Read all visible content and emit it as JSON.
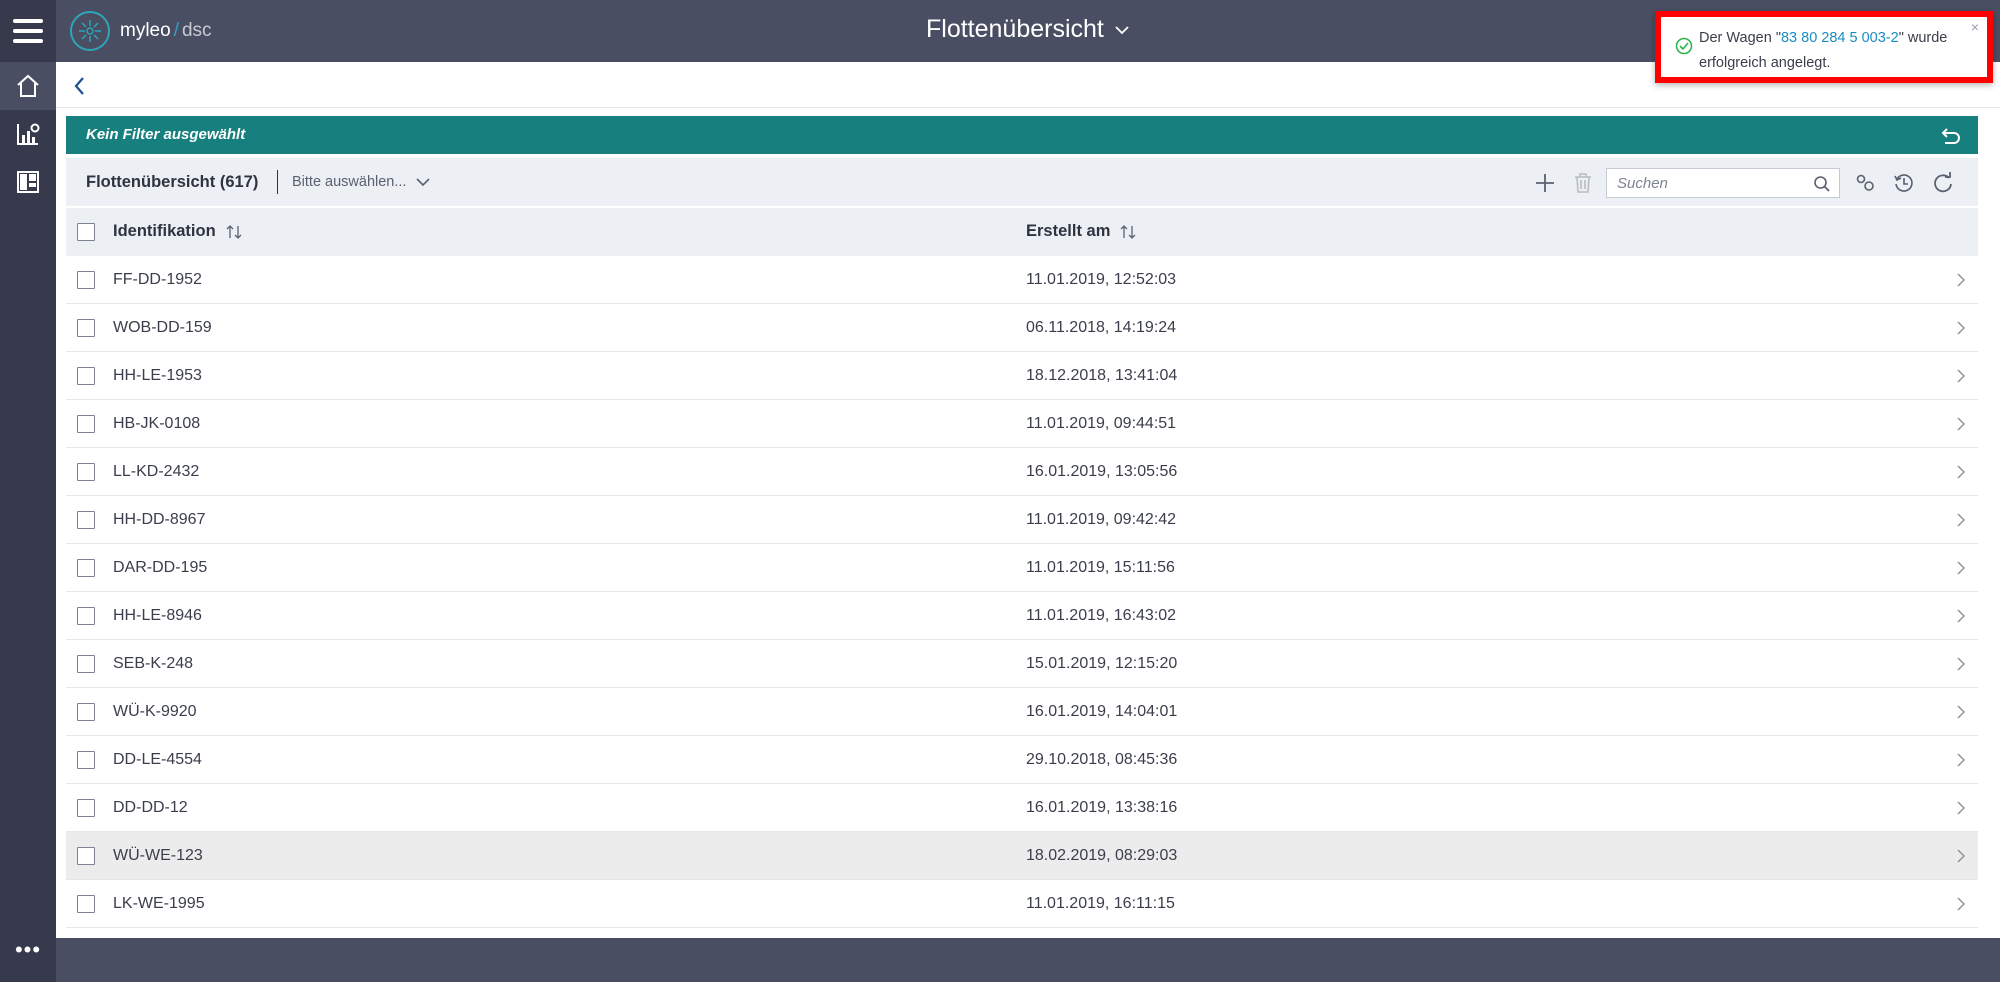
{
  "app": {
    "brand": "myleo",
    "brand_sub": "dsc"
  },
  "header": {
    "title": "Flottenübersicht"
  },
  "rail": {
    "more_label": "•••"
  },
  "toast": {
    "prefix": "Der Wagen \"",
    "link": "83 80 284 5 003-2",
    "suffix": "\" wurde erfolgreich angelegt.",
    "close_label": "×"
  },
  "filter": {
    "label": "Kein Filter ausgewählt"
  },
  "toolbar": {
    "title": "Flottenübersicht (617)",
    "select_value": "Bitte auswählen...",
    "search_placeholder": "Suchen"
  },
  "table": {
    "columns": [
      "Identifikation",
      "Erstellt am"
    ],
    "rows": [
      {
        "id": "FF-DD-1952",
        "created": "11.01.2019, 12:52:03"
      },
      {
        "id": "WOB-DD-159",
        "created": "06.11.2018, 14:19:24"
      },
      {
        "id": "HH-LE-1953",
        "created": "18.12.2018, 13:41:04"
      },
      {
        "id": "HB-JK-0108",
        "created": "11.01.2019, 09:44:51"
      },
      {
        "id": "LL-KD-2432",
        "created": "16.01.2019, 13:05:56"
      },
      {
        "id": "HH-DD-8967",
        "created": "11.01.2019, 09:42:42"
      },
      {
        "id": "DAR-DD-195",
        "created": "11.01.2019, 15:11:56"
      },
      {
        "id": "HH-LE-8946",
        "created": "11.01.2019, 16:43:02"
      },
      {
        "id": "SEB-K-248",
        "created": "15.01.2019, 12:15:20"
      },
      {
        "id": "WÜ-K-9920",
        "created": "16.01.2019, 14:04:01"
      },
      {
        "id": "DD-LE-4554",
        "created": "29.10.2018, 08:45:36"
      },
      {
        "id": "DD-DD-12",
        "created": "16.01.2019, 13:38:16"
      },
      {
        "id": "WÜ-WE-123",
        "created": "18.02.2019, 08:29:03"
      },
      {
        "id": "LK-WE-1995",
        "created": "11.01.2019, 16:11:15"
      }
    ]
  },
  "colors": {
    "topbar": "#4a4e63",
    "rail": "#363a4c",
    "filter_bar": "#177f7d",
    "accent_link": "#1a8cc4",
    "toast_highlight": "#ff0000",
    "success": "#2bb24c"
  },
  "icons": {
    "rail": [
      "menu-icon",
      "home-icon",
      "chart-settings-icon",
      "dashboard-icon",
      "more-icon"
    ],
    "toolbar": [
      "add-icon",
      "trash-icon",
      "search-icon",
      "settings-icon",
      "history-icon",
      "refresh-icon"
    ]
  }
}
